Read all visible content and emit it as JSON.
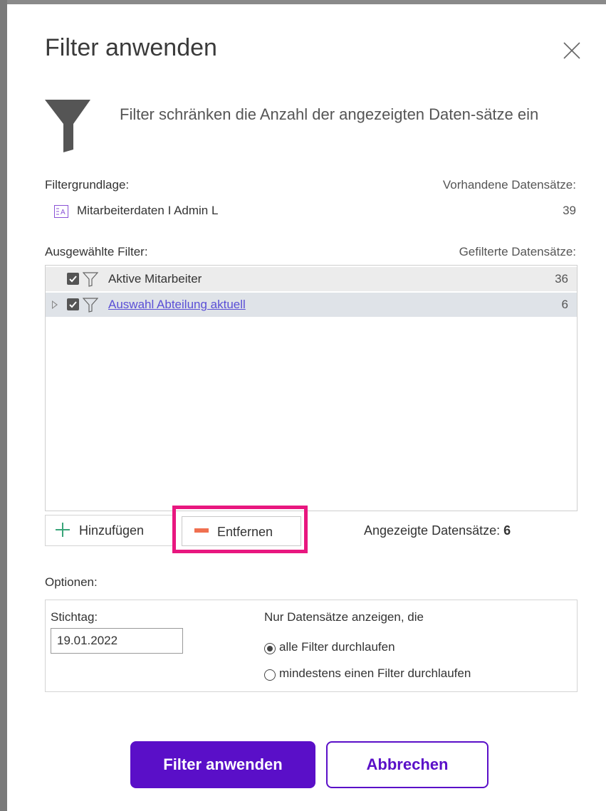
{
  "dialog": {
    "title": "Filter anwenden",
    "subtitle": "Filter schränken die Anzahl der angezeigten Daten-sätze ein"
  },
  "basis": {
    "label": "Filtergrundlage:",
    "available_label": "Vorhandene Datensätze:",
    "source_name": "Mitarbeiterdaten I Admin L",
    "source_count": "39"
  },
  "filters": {
    "label": "Ausgewählte Filter:",
    "filtered_label": "Gefilterte Datensätze:",
    "items": [
      {
        "name": "Aktive Mitarbeiter",
        "count": "36",
        "checked": true
      },
      {
        "name": "Auswahl Abteilung aktuell",
        "count": "6",
        "checked": true
      }
    ]
  },
  "actions": {
    "add_label": "Hinzufügen",
    "remove_label": "Entfernen",
    "shown_label": "Angezeigte Datensätze:",
    "shown_count": "6"
  },
  "options": {
    "label": "Optionen:",
    "date_label": "Stichtag:",
    "date_value": "19.01.2022",
    "mode_label": "Nur Datensätze anzeigen, die",
    "radio_all": "alle Filter durchlaufen",
    "radio_any": "mindestens einen Filter durchlaufen",
    "selected": "all"
  },
  "footer": {
    "apply_label": "Filter anwenden",
    "cancel_label": "Abbrechen"
  },
  "colors": {
    "primary": "#5a0fc8",
    "highlight": "#e8177f",
    "add_icon": "#3aa57a",
    "remove_icon": "#f07050",
    "link": "#5a4fd6"
  }
}
